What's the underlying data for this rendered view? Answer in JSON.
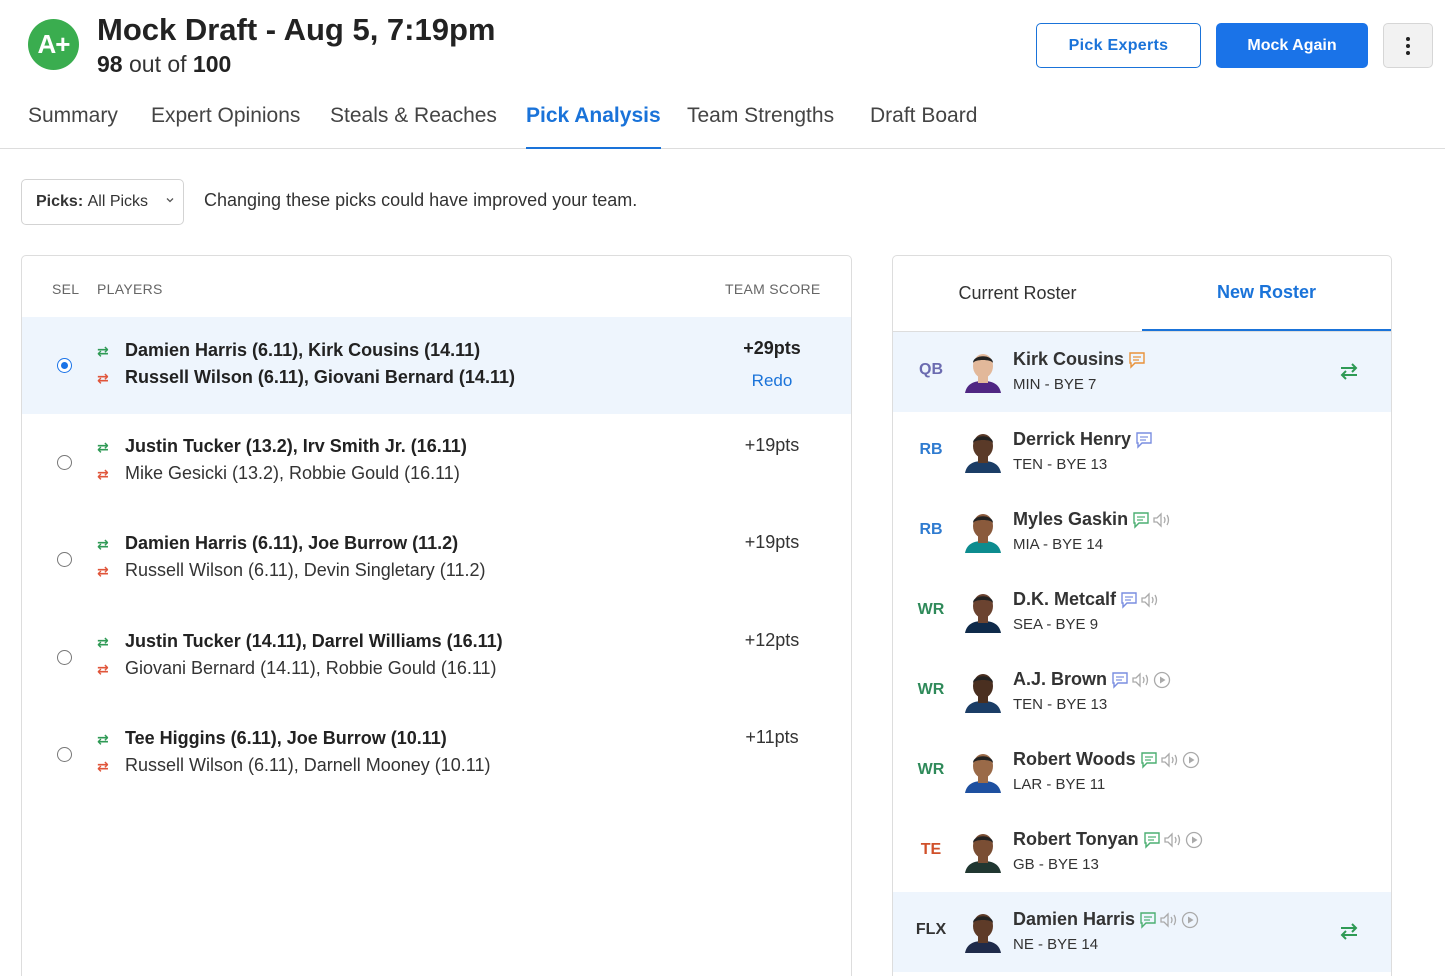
{
  "header": {
    "grade": "A+",
    "title": "Mock Draft - Aug 5, 7:19pm",
    "score": "98",
    "score_mid": " out of ",
    "score_max": "100",
    "pick_experts_label": "Pick Experts",
    "mock_again_label": "Mock Again"
  },
  "tabs": [
    {
      "label": "Summary"
    },
    {
      "label": "Expert Opinions"
    },
    {
      "label": "Steals & Reaches"
    },
    {
      "label": "Pick Analysis"
    },
    {
      "label": "Team Strengths"
    },
    {
      "label": "Draft Board"
    }
  ],
  "filter": {
    "select_label": "Picks:",
    "select_value": "All Picks",
    "description": "Changing these picks could have improved your team."
  },
  "table": {
    "col_sel": "SEL",
    "col_players": "PLAYERS",
    "col_score": "TEAM SCORE",
    "redo_label": "Redo",
    "rows": [
      {
        "add": "Damien Harris (6.11), Kirk Cousins (14.11)",
        "drop": "Russell Wilson (6.11), Giovani Bernard (14.11)",
        "pts": "+29pts",
        "selected": true
      },
      {
        "add": "Justin Tucker (13.2), Irv Smith Jr. (16.11)",
        "drop": "Mike Gesicki (13.2), Robbie Gould (16.11)",
        "pts": "+19pts",
        "selected": false
      },
      {
        "add": "Damien Harris (6.11), Joe Burrow (11.2)",
        "drop": "Russell Wilson (6.11), Devin Singletary (11.2)",
        "pts": "+19pts",
        "selected": false
      },
      {
        "add": "Justin Tucker (14.11), Darrel Williams (16.11)",
        "drop": "Giovani Bernard (14.11), Robbie Gould (16.11)",
        "pts": "+12pts",
        "selected": false
      },
      {
        "add": "Tee Higgins (6.11), Joe Burrow (10.11)",
        "drop": "Russell Wilson (6.11), Darnell Mooney (10.11)",
        "pts": "+11pts",
        "selected": false
      }
    ]
  },
  "roster": {
    "tab_current": "Current Roster",
    "tab_new": "New Roster",
    "players": [
      {
        "pos": "QB",
        "name": "Kirk Cousins",
        "info": "MIN - BYE 7",
        "pos_color": "#6b6bb0",
        "highlight": true
      },
      {
        "pos": "RB",
        "name": "Derrick Henry",
        "info": "TEN - BYE 13",
        "pos_color": "#2f7bd0",
        "highlight": false
      },
      {
        "pos": "RB",
        "name": "Myles Gaskin",
        "info": "MIA - BYE 14",
        "pos_color": "#2f7bd0",
        "highlight": false
      },
      {
        "pos": "WR",
        "name": "D.K. Metcalf",
        "info": "SEA - BYE 9",
        "pos_color": "#2f8a5a",
        "highlight": false
      },
      {
        "pos": "WR",
        "name": "A.J. Brown",
        "info": "TEN - BYE 13",
        "pos_color": "#2f8a5a",
        "highlight": false
      },
      {
        "pos": "WR",
        "name": "Robert Woods",
        "info": "LAR - BYE 11",
        "pos_color": "#2f8a5a",
        "highlight": false
      },
      {
        "pos": "TE",
        "name": "Robert Tonyan",
        "info": "GB - BYE 13",
        "pos_color": "#d0502a",
        "highlight": false
      },
      {
        "pos": "FLX",
        "name": "Damien Harris",
        "info": "NE - BYE 14",
        "pos_color": "#333333",
        "highlight": true
      }
    ]
  },
  "colors": {
    "accent": "#1a73e8",
    "grade_green": "#3aad4f",
    "add_green": "#2f9a55",
    "drop_red": "#e0553a",
    "selected_bg": "#eef5fd"
  },
  "icons": [
    "grade-badge",
    "more-vertical-icon",
    "chevron-down-icon",
    "swap-icon",
    "note-icon",
    "audio-icon",
    "play-icon"
  ]
}
